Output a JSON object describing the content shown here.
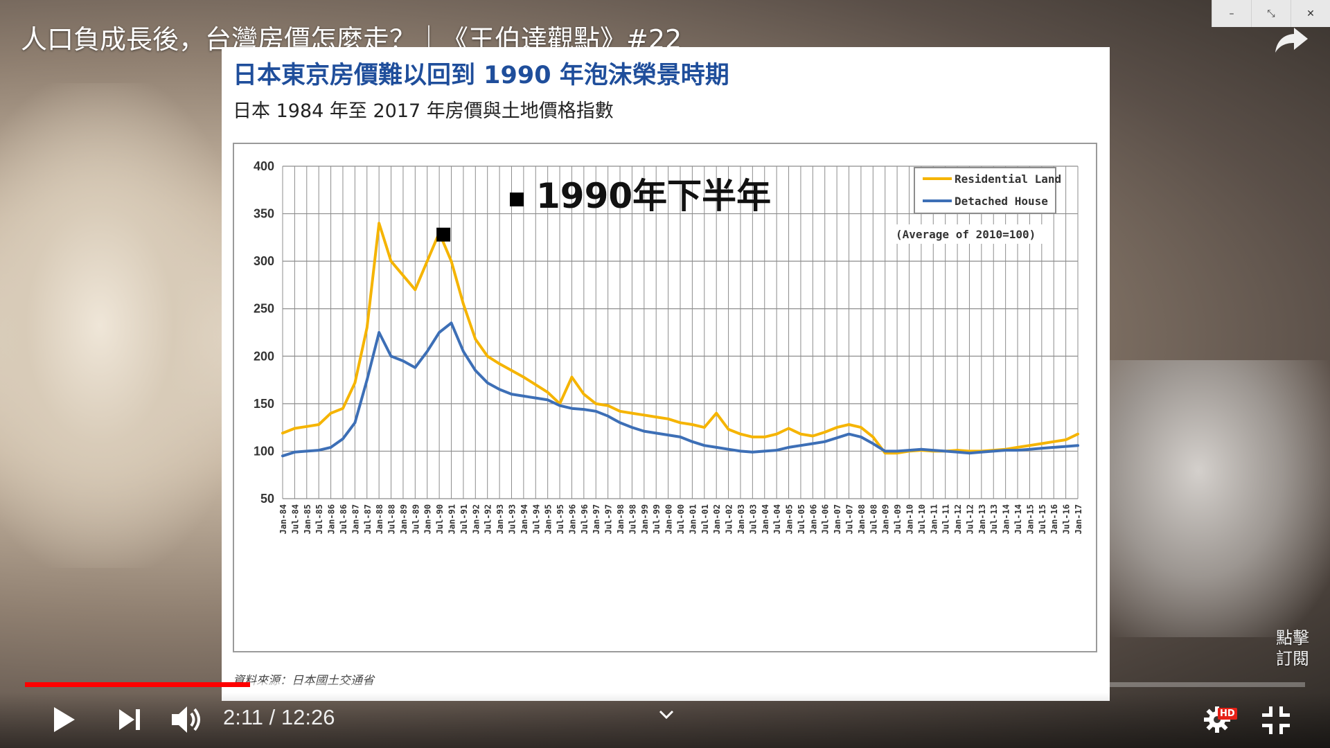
{
  "video": {
    "title": "人口負成長後，台灣房價怎麼走？｜《王伯達觀點》#22",
    "time_current": "2:11",
    "time_total": "12:26",
    "time_display": "2:11 / 12:26",
    "progress_fraction": 0.1756,
    "buffered_fraction": 0.2
  },
  "window_controls": {
    "minimize": "–",
    "restore": "⤡",
    "close": "✕"
  },
  "slide": {
    "title": "日本東京房價難以回到 1990 年泡沫榮景時期",
    "subtitle": "日本 1984 年至 2017 年房價與土地價格指數",
    "source": "資料來源：日本國土交通省",
    "annotation": "1990年下半年",
    "note": "(Average of 2010=100)"
  },
  "subscribe": {
    "line1": "點擊",
    "line2": "訂閱"
  },
  "icons": {
    "play": "play-icon",
    "next": "next-icon",
    "volume": "volume-icon",
    "chevron": "chevron-down-icon",
    "settings": "gear-icon",
    "hd": "HD",
    "exit_fullscreen": "exit-fullscreen-icon",
    "share": "share-icon"
  },
  "colors": {
    "accent": "#ff0000",
    "slide_title": "#1f4e9b",
    "residential": "#f5b400",
    "detached": "#3d6fb6"
  },
  "chart_data": {
    "type": "line",
    "title": "",
    "xlabel": "",
    "ylabel": "",
    "ylim": [
      50,
      400
    ],
    "yticks": [
      50,
      100,
      150,
      200,
      250,
      300,
      350,
      400
    ],
    "grid": true,
    "legend": "top-right",
    "x_tick_labels": [
      "Jan-84",
      "Jul-84",
      "Jan-85",
      "Jul-85",
      "Jan-86",
      "Jul-86",
      "Jan-87",
      "Jul-87",
      "Jan-88",
      "Jul-88",
      "Jan-89",
      "Jul-89",
      "Jan-90",
      "Jul-90",
      "Jan-91",
      "Jul-91",
      "Jan-92",
      "Jul-92",
      "Jan-93",
      "Jul-93",
      "Jan-94",
      "Jul-94",
      "Jan-95",
      "Jul-95",
      "Jan-96",
      "Jul-96",
      "Jan-97",
      "Jul-97",
      "Jan-98",
      "Jul-98",
      "Jan-99",
      "Jul-99",
      "Jan-00",
      "Jul-00",
      "Jan-01",
      "Jul-01",
      "Jan-02",
      "Jul-02",
      "Jan-03",
      "Jul-03",
      "Jan-04",
      "Jul-04",
      "Jan-05",
      "Jul-05",
      "Jan-06",
      "Jul-06",
      "Jan-07",
      "Jul-07",
      "Jan-08",
      "Jul-08",
      "Jan-09",
      "Jul-09",
      "Jan-10",
      "Jul-10",
      "Jan-11",
      "Jul-11",
      "Jan-12",
      "Jul-12",
      "Jan-13",
      "Jul-13",
      "Jan-14",
      "Jul-14",
      "Jan-15",
      "Jul-15",
      "Jan-16",
      "Jul-16",
      "Jan-17"
    ],
    "markers": [
      {
        "label": "",
        "x": "Jul-90",
        "y": 328
      }
    ],
    "series": [
      {
        "name": "Residential Land",
        "color": "#f5b400",
        "values": [
          119,
          124,
          126,
          128,
          140,
          145,
          172,
          230,
          340,
          300,
          285,
          270,
          300,
          330,
          300,
          255,
          218,
          200,
          192,
          185,
          178,
          170,
          162,
          150,
          178,
          160,
          150,
          148,
          142,
          140,
          138,
          136,
          134,
          130,
          128,
          125,
          140,
          123,
          118,
          115,
          115,
          118,
          124,
          118,
          116,
          120,
          125,
          128,
          125,
          115,
          98,
          98,
          100,
          101,
          100,
          100,
          101,
          100,
          100,
          101,
          102,
          104,
          106,
          108,
          110,
          112,
          118
        ]
      },
      {
        "name": "Detached House",
        "color": "#3d6fb6",
        "values": [
          95,
          99,
          100,
          101,
          104,
          113,
          130,
          175,
          225,
          200,
          195,
          188,
          205,
          225,
          235,
          205,
          185,
          172,
          165,
          160,
          158,
          156,
          154,
          148,
          145,
          144,
          142,
          137,
          130,
          125,
          121,
          119,
          117,
          115,
          110,
          106,
          104,
          102,
          100,
          99,
          100,
          101,
          104,
          106,
          108,
          110,
          114,
          118,
          115,
          108,
          100,
          100,
          101,
          102,
          101,
          100,
          99,
          98,
          99,
          100,
          101,
          101,
          102,
          103,
          104,
          105,
          106
        ]
      }
    ]
  }
}
